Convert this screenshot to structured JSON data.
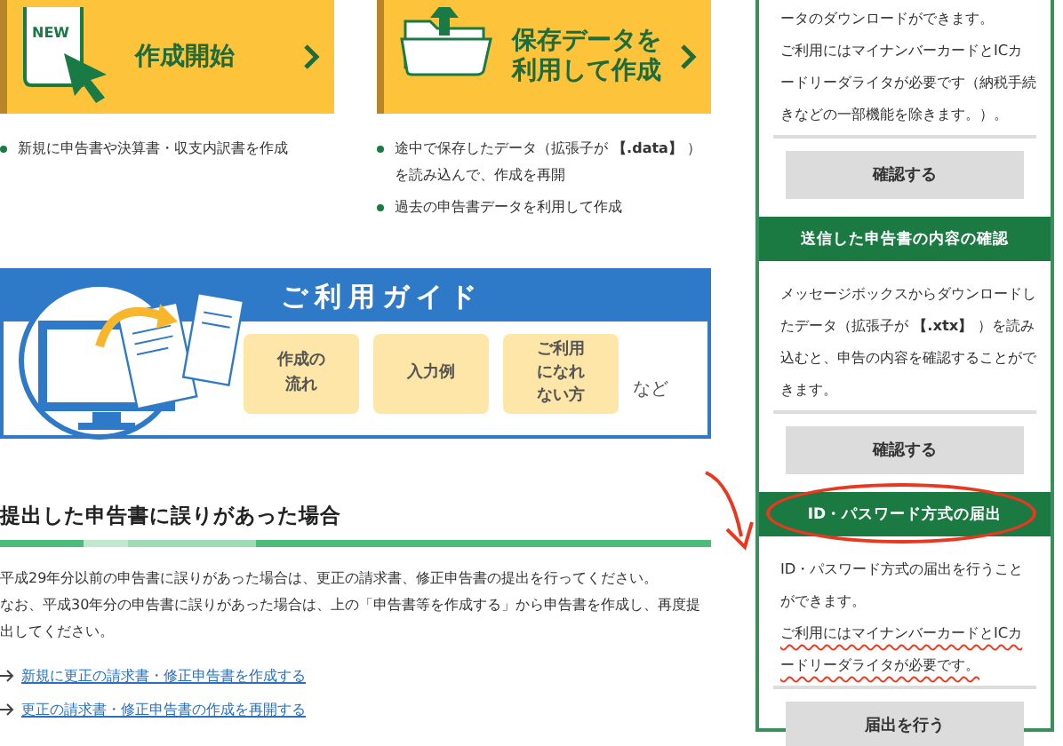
{
  "start_cards": [
    {
      "kind": "new",
      "badge": "NEW",
      "label": "作成開始",
      "bullets": [
        "新規に申告書や決算書・収支内訳書を作成"
      ]
    },
    {
      "kind": "folder",
      "label": "保存データを利用して作成",
      "bullets": [
        "途中で保存したデータ（拡張子が **【.data】** ）を読み込んで、作成を再開",
        "過去の申告書データを利用して作成"
      ]
    }
  ],
  "guide": {
    "title": "ご利用ガイド",
    "items": [
      "作成の流れ",
      "入力例",
      "ご利用になれない方"
    ],
    "suffix": "など"
  },
  "correction": {
    "heading": "提出した申告書に誤りがあった場合",
    "paragraphs": [
      "平成29年分以前の申告書に誤りがあった場合は、更正の請求書、修正申告書の提出を行ってください。",
      "なお、平成30年分の申告書に誤りがあった場合は、上の「申告書等を作成する」から申告書を作成し、再度提出してください。"
    ],
    "links": [
      "新規に更正の請求書・修正申告書を作成する",
      "更正の請求書・修正申告書の作成を再開する"
    ]
  },
  "side_panel": [
    {
      "circled": false,
      "paragraphs": [
        {
          "text": "ータのダウンロードができます。",
          "underlined": false
        },
        {
          "text": "ご利用にはマイナンバーカードとICカードリーダライタが必要です（納税手続きなどの一部機能を除きます。）。",
          "underlined": false
        }
      ],
      "button": "確認する"
    },
    {
      "header": "送信した申告書の内容の確認",
      "circled": false,
      "paragraphs": [
        {
          "text": "メッセージボックスからダウンロードしたデータ（拡張子が **【.xtx】** ）を読み込むと、申告の内容を確認することができます。",
          "underlined": false
        }
      ],
      "button": "確認する"
    },
    {
      "header": "ID・パスワード方式の届出",
      "circled": true,
      "paragraphs": [
        {
          "text": "ID・パスワード方式の届出を行うことができます。",
          "underlined": false
        },
        {
          "text": "ご利用にはマイナンバーカードとICカードリーダライタが必要です。",
          "underlined": true
        }
      ],
      "button": "届出を行う"
    }
  ]
}
